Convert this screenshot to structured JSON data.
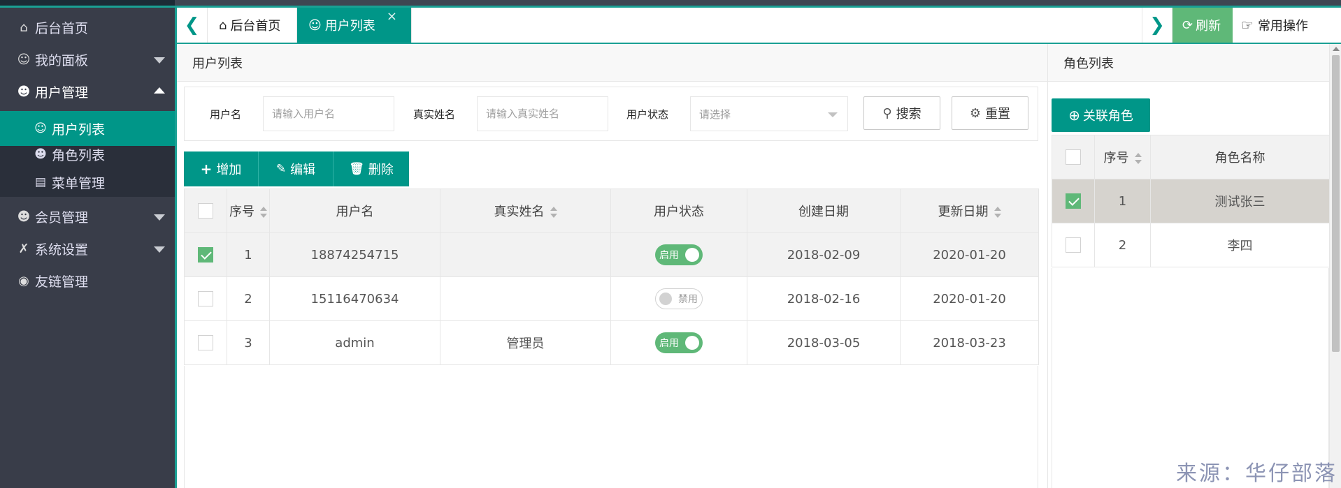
{
  "sidebar": {
    "items": [
      {
        "label": "后台首页",
        "icon": "home-icon"
      },
      {
        "label": "我的面板",
        "icon": "user-icon"
      },
      {
        "label": "用户管理",
        "icon": "user-manage-icon"
      },
      {
        "label": "会员管理",
        "icon": "members-icon"
      },
      {
        "label": "系统设置",
        "icon": "tools-icon"
      },
      {
        "label": "友链管理",
        "icon": "globe-icon"
      }
    ],
    "sub_items": [
      {
        "label": "用户列表",
        "icon": "user-icon"
      },
      {
        "label": "角色列表",
        "icon": "role-icon"
      },
      {
        "label": "菜单管理",
        "icon": "menu-icon"
      }
    ]
  },
  "tabs": {
    "home": "后台首页",
    "user_list": "用户列表",
    "close": "×",
    "refresh": "刷新",
    "common_ops": "常用操作"
  },
  "user_panel": {
    "title": "用户列表",
    "search": {
      "username_label": "用户名",
      "username_placeholder": "请输入用户名",
      "realname_label": "真实姓名",
      "realname_placeholder": "请输入真实姓名",
      "status_label": "用户状态",
      "status_placeholder": "请选择",
      "search_button": "搜索",
      "reset_button": "重置"
    },
    "toolbar": {
      "add": "增加",
      "edit": "编辑",
      "delete": "删除"
    },
    "columns": [
      "序号",
      "用户名",
      "真实姓名",
      "用户状态",
      "创建日期",
      "更新日期"
    ],
    "rows": [
      {
        "no": "1",
        "username": "18874254715",
        "realname": "",
        "status": "启用",
        "status_on": true,
        "created": "2018-02-09",
        "updated": "2020-01-20",
        "checked": true
      },
      {
        "no": "2",
        "username": "15116470634",
        "realname": "",
        "status": "禁用",
        "status_on": false,
        "created": "2018-02-16",
        "updated": "2020-01-20",
        "checked": false
      },
      {
        "no": "3",
        "username": "admin",
        "realname": "管理员",
        "status": "启用",
        "status_on": true,
        "created": "2018-03-05",
        "updated": "2018-03-23",
        "checked": false
      }
    ]
  },
  "role_panel": {
    "title": "角色列表",
    "link_button": "关联角色",
    "columns": [
      "序号",
      "角色名称"
    ],
    "rows": [
      {
        "no": "1",
        "name": "测试张三",
        "checked": true
      },
      {
        "no": "2",
        "name": "李四",
        "checked": false
      }
    ]
  },
  "watermark": "来源：华仔部落",
  "colors": {
    "accent": "#009688",
    "sidebar_bg": "#393d49",
    "green": "#5fb878"
  }
}
